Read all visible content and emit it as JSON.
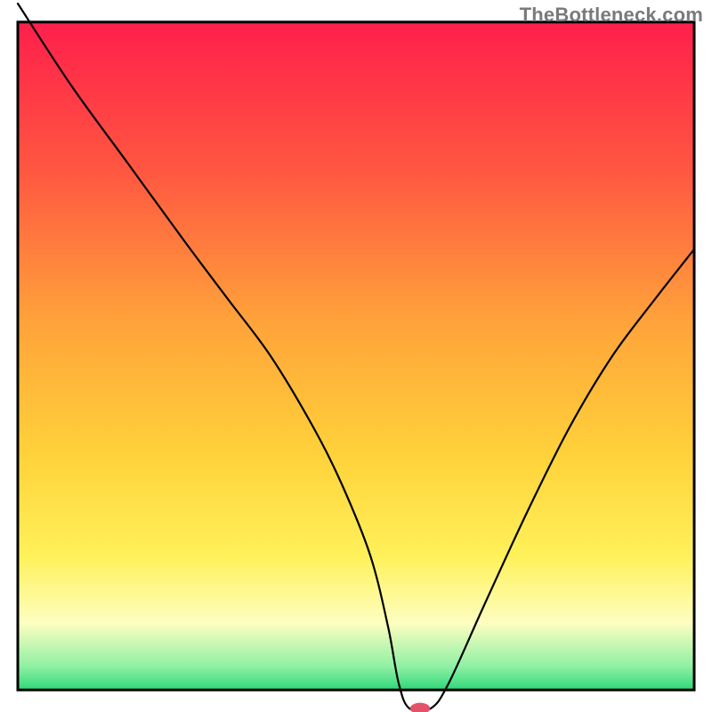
{
  "watermark": "TheBottleneck.com",
  "chart_data": {
    "type": "line",
    "title": "",
    "xlabel": "",
    "ylabel": "",
    "xlim": [
      0,
      100
    ],
    "ylim": [
      0,
      100
    ],
    "grid": false,
    "legend": false,
    "background_gradient_stops": [
      {
        "offset": 0.0,
        "color": "#ff1f4b"
      },
      {
        "offset": 0.22,
        "color": "#ff5641"
      },
      {
        "offset": 0.45,
        "color": "#ffa33a"
      },
      {
        "offset": 0.65,
        "color": "#ffd23a"
      },
      {
        "offset": 0.8,
        "color": "#fff15a"
      },
      {
        "offset": 0.9,
        "color": "#fdfec0"
      },
      {
        "offset": 0.965,
        "color": "#8ff0a4"
      },
      {
        "offset": 1.0,
        "color": "#2fd879"
      }
    ],
    "frame": {
      "x": 2.5,
      "y": 3.1,
      "w": 95.0,
      "h": 93.8
    },
    "series": [
      {
        "name": "bottleneck-curve",
        "x": [
          2.5,
          10,
          18,
          26,
          32,
          38,
          44,
          48,
          52,
          54.5,
          56,
          57.5,
          60.5,
          63,
          68,
          74,
          80,
          86,
          92,
          97.5
        ],
        "values": [
          99.5,
          88,
          77,
          66,
          58,
          50,
          40,
          32,
          22,
          12,
          4,
          0.5,
          0.5,
          4,
          15,
          28,
          40,
          50,
          58,
          65
        ]
      }
    ],
    "marker": {
      "x": 59,
      "y": 0.5,
      "rx": 1.4,
      "ry": 0.8,
      "color": "#e2536a"
    }
  }
}
